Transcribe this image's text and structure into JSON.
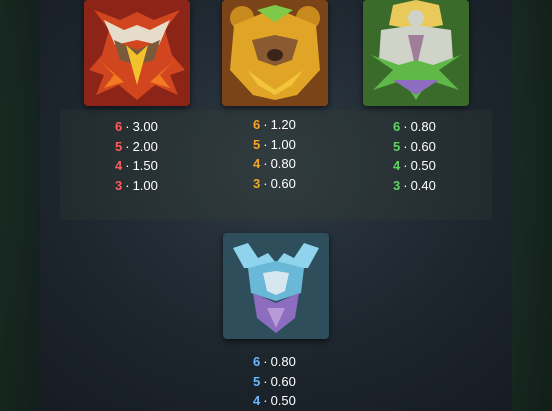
{
  "symbols": [
    {
      "id": "owl",
      "icon": "owl-totem-mask-icon",
      "payouts": [
        {
          "count": "6",
          "value": "3.00",
          "color": "#ff5a5a"
        },
        {
          "count": "5",
          "value": "2.00",
          "color": "#ff5a5a"
        },
        {
          "count": "4",
          "value": "1.50",
          "color": "#ff5a5a"
        },
        {
          "count": "3",
          "value": "1.00",
          "color": "#ff5a5a"
        }
      ]
    },
    {
      "id": "bear",
      "icon": "bear-totem-mask-icon",
      "payouts": [
        {
          "count": "6",
          "value": "1.20",
          "color": "#f5a623"
        },
        {
          "count": "5",
          "value": "1.00",
          "color": "#f5a623"
        },
        {
          "count": "4",
          "value": "0.80",
          "color": "#f5a623"
        },
        {
          "count": "3",
          "value": "0.60",
          "color": "#f5a623"
        }
      ]
    },
    {
      "id": "wolf",
      "icon": "wolf-totem-mask-icon",
      "payouts": [
        {
          "count": "6",
          "value": "0.80",
          "color": "#5fd35f"
        },
        {
          "count": "5",
          "value": "0.60",
          "color": "#5fd35f"
        },
        {
          "count": "4",
          "value": "0.50",
          "color": "#5fd35f"
        },
        {
          "count": "3",
          "value": "0.40",
          "color": "#5fd35f"
        }
      ]
    },
    {
      "id": "elk",
      "icon": "elk-totem-mask-icon",
      "payouts": [
        {
          "count": "6",
          "value": "0.80",
          "color": "#6ab8ff"
        },
        {
          "count": "5",
          "value": "0.60",
          "color": "#6ab8ff"
        },
        {
          "count": "4",
          "value": "0.50",
          "color": "#6ab8ff"
        }
      ]
    }
  ],
  "separator": "·"
}
